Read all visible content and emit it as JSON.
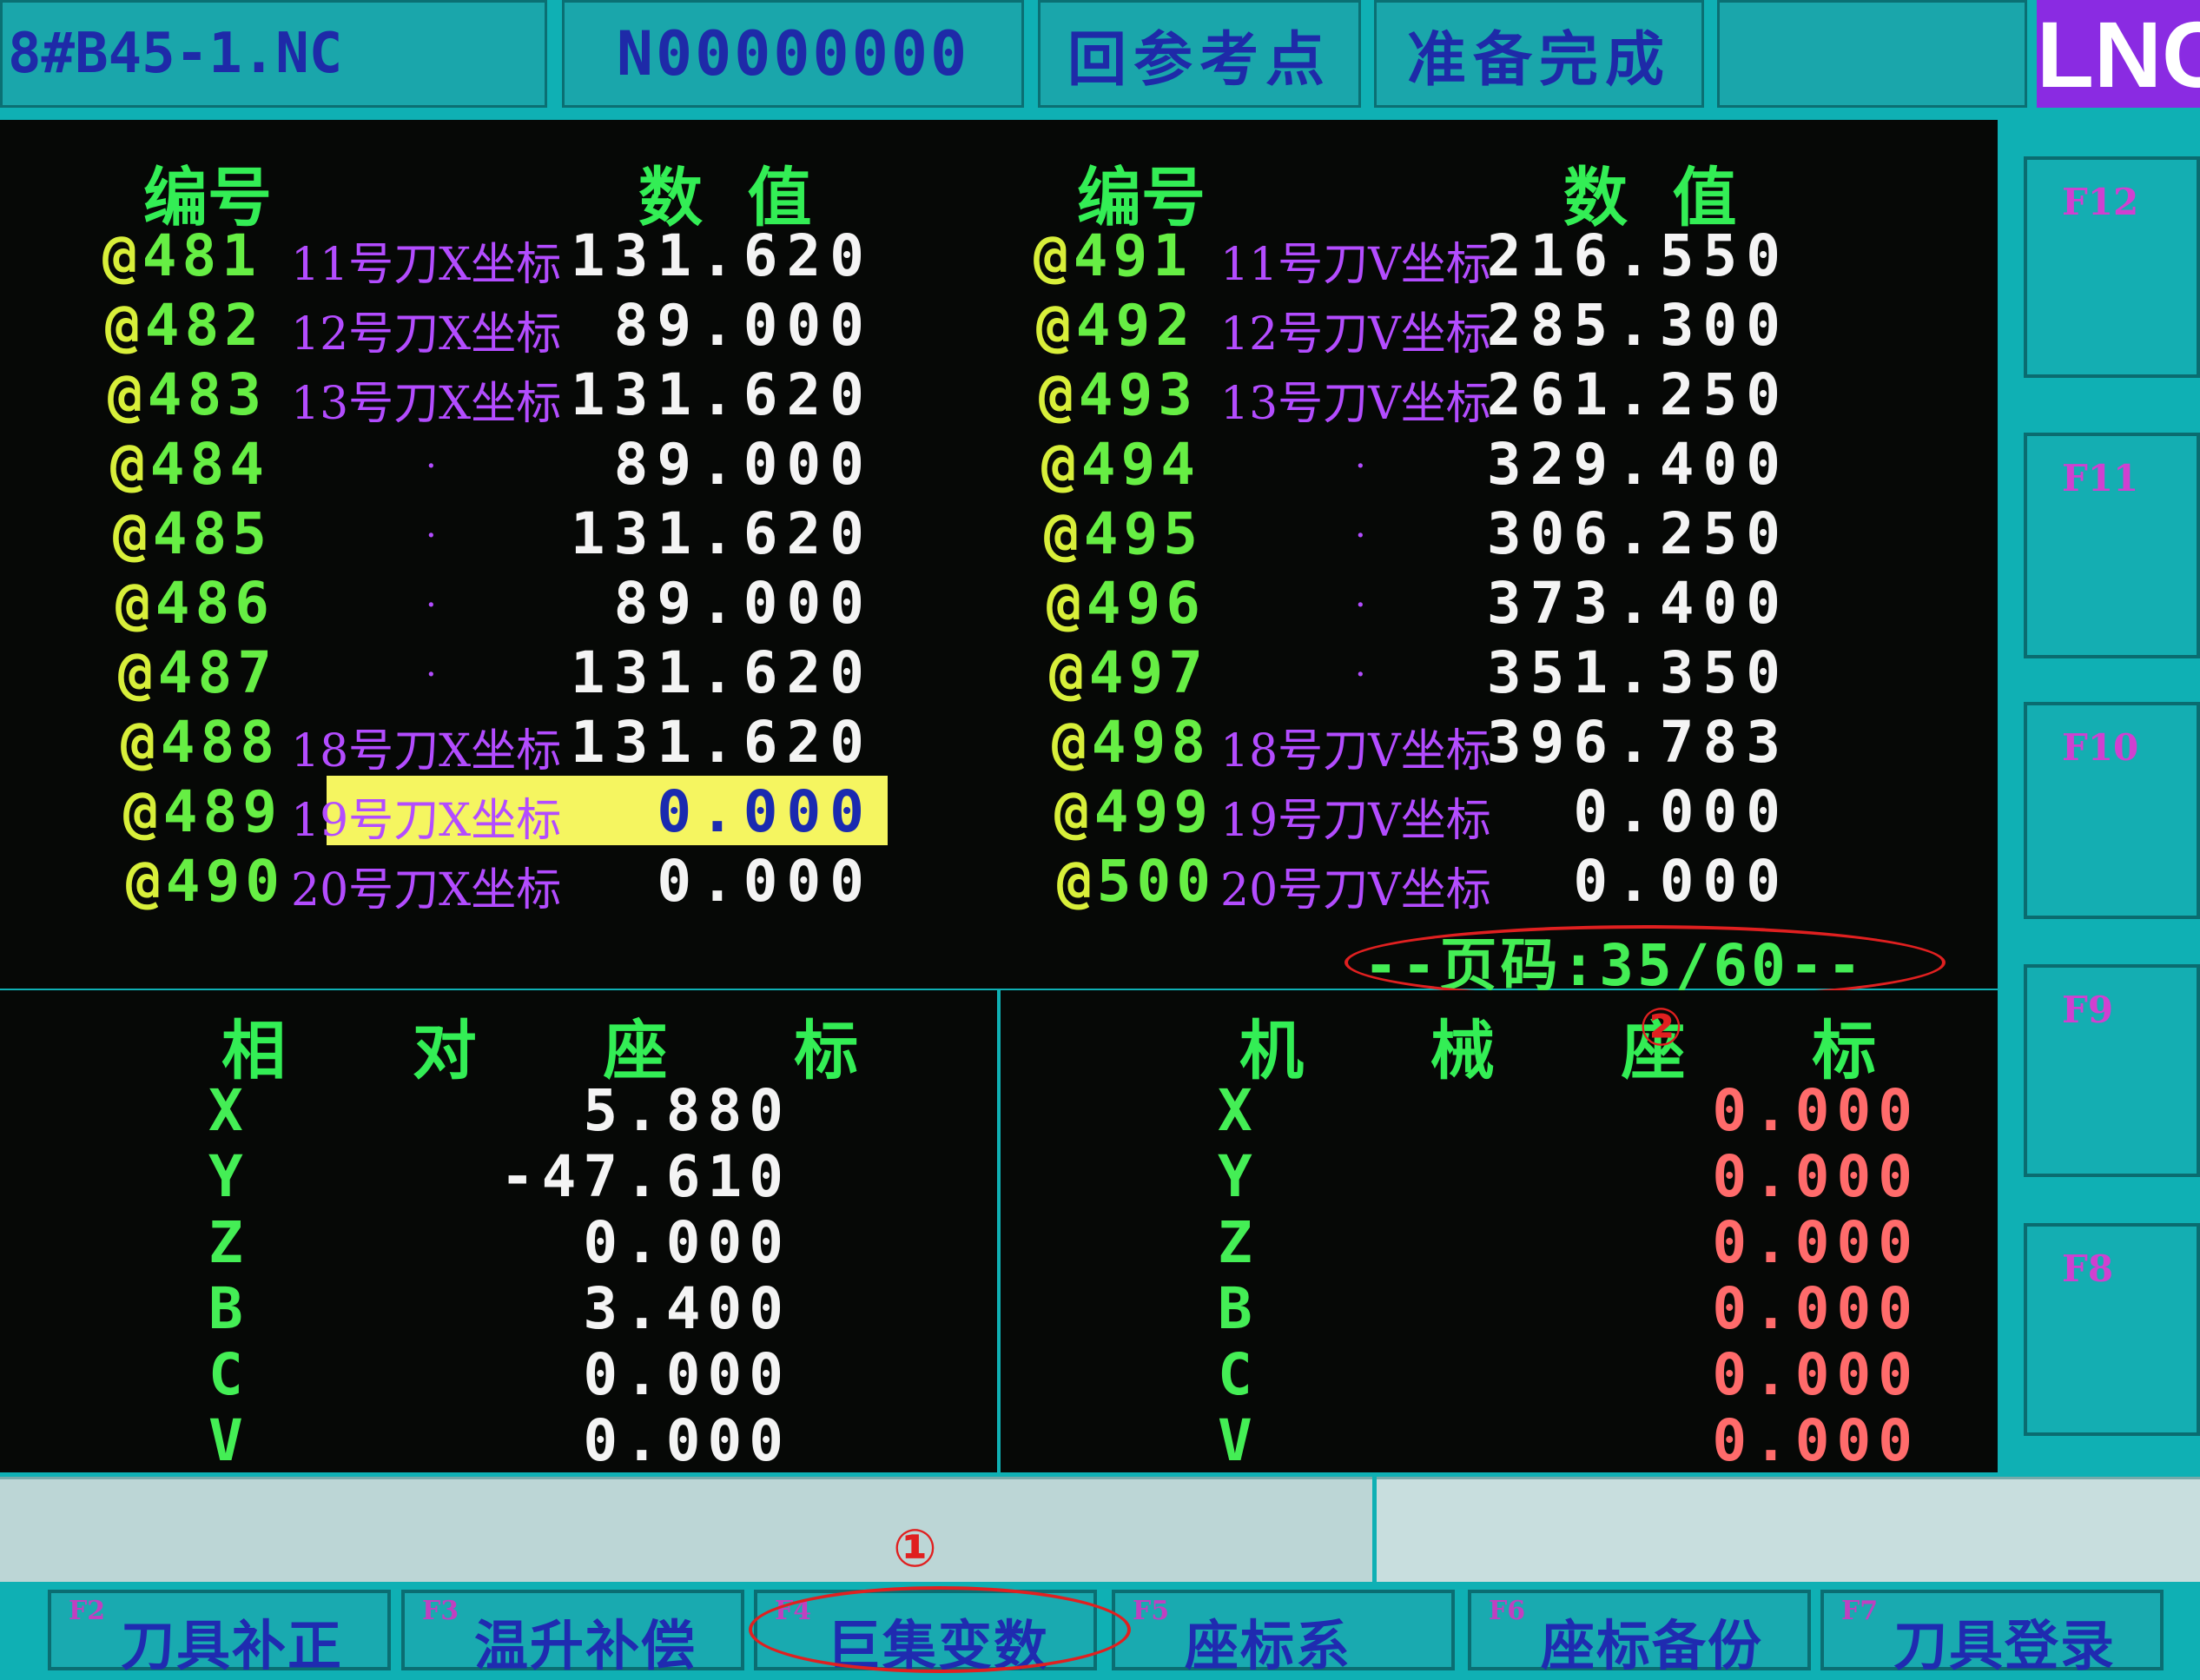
{
  "top_bar": {
    "program_file": "8#B45-1.NC",
    "sequence_number": "N00000000",
    "reference_mode": "回参考点",
    "status": "准备完成",
    "logo": "LNC"
  },
  "macro_table": {
    "header_id": "编号",
    "header_value": "数  值",
    "left_rows": [
      {
        "id": "@481",
        "desc": "11号刀X坐标",
        "value": "131.620"
      },
      {
        "id": "@482",
        "desc": "12号刀X坐标",
        "value": "89.000"
      },
      {
        "id": "@483",
        "desc": "13号刀X坐标",
        "value": "131.620"
      },
      {
        "id": "@484",
        "desc": "·",
        "value": "89.000"
      },
      {
        "id": "@485",
        "desc": "·",
        "value": "131.620"
      },
      {
        "id": "@486",
        "desc": "·",
        "value": "89.000"
      },
      {
        "id": "@487",
        "desc": "·",
        "value": "131.620"
      },
      {
        "id": "@488",
        "desc": "18号刀X坐标",
        "value": "131.620"
      },
      {
        "id": "@489",
        "desc": "19号刀X坐标",
        "value": "0.000"
      },
      {
        "id": "@490",
        "desc": "20号刀X坐标",
        "value": "0.000"
      }
    ],
    "right_rows": [
      {
        "id": "@491",
        "desc": "11号刀V坐标",
        "value": "216.550"
      },
      {
        "id": "@492",
        "desc": "12号刀V坐标",
        "value": "285.300"
      },
      {
        "id": "@493",
        "desc": "13号刀V坐标",
        "value": "261.250"
      },
      {
        "id": "@494",
        "desc": "·",
        "value": "329.400"
      },
      {
        "id": "@495",
        "desc": "·",
        "value": "306.250"
      },
      {
        "id": "@496",
        "desc": "·",
        "value": "373.400"
      },
      {
        "id": "@497",
        "desc": "·",
        "value": "351.350"
      },
      {
        "id": "@498",
        "desc": "18号刀V坐标",
        "value": "396.783"
      },
      {
        "id": "@499",
        "desc": "19号刀V坐标",
        "value": "0.000"
      },
      {
        "id": "@500",
        "desc": "20号刀V坐标",
        "value": "0.000"
      }
    ],
    "selected_id": "@489",
    "page_indicator": "--页码:35/60--"
  },
  "relative_coords": {
    "title": "相 对 座 标",
    "axes": [
      {
        "axis": "X",
        "value": "5.880"
      },
      {
        "axis": "Y",
        "value": "-47.610"
      },
      {
        "axis": "Z",
        "value": "0.000"
      },
      {
        "axis": "B",
        "value": "3.400"
      },
      {
        "axis": "C",
        "value": "0.000"
      },
      {
        "axis": "V",
        "value": "0.000"
      }
    ]
  },
  "machine_coords": {
    "title": "机 械 座 标",
    "axes": [
      {
        "axis": "X",
        "value": "0.000"
      },
      {
        "axis": "Y",
        "value": "0.000"
      },
      {
        "axis": "Z",
        "value": "0.000"
      },
      {
        "axis": "B",
        "value": "0.000"
      },
      {
        "axis": "C",
        "value": "0.000"
      },
      {
        "axis": "V",
        "value": "0.000"
      }
    ]
  },
  "side_keys": [
    "F12",
    "F11",
    "F10",
    "F9",
    "F8"
  ],
  "soft_keys": [
    {
      "fkey": "F2",
      "label": "刀具补正"
    },
    {
      "fkey": "F3",
      "label": "温升补偿"
    },
    {
      "fkey": "F4",
      "label": "巨集变数"
    },
    {
      "fkey": "F5",
      "label": "座标系"
    },
    {
      "fkey": "F6",
      "label": "座标备份"
    },
    {
      "fkey": "F7",
      "label": "刀具登录"
    }
  ],
  "annotations": {
    "marker_1": "①",
    "marker_2": "②"
  },
  "colors": {
    "background": "#0fb0b4",
    "panel": "#060806",
    "header_green": "#33ee55",
    "desc_purple": "#b34cff",
    "highlight": "#f5f560",
    "machine_value_red": "#ff6b6b",
    "annotation_red": "#e02020"
  }
}
